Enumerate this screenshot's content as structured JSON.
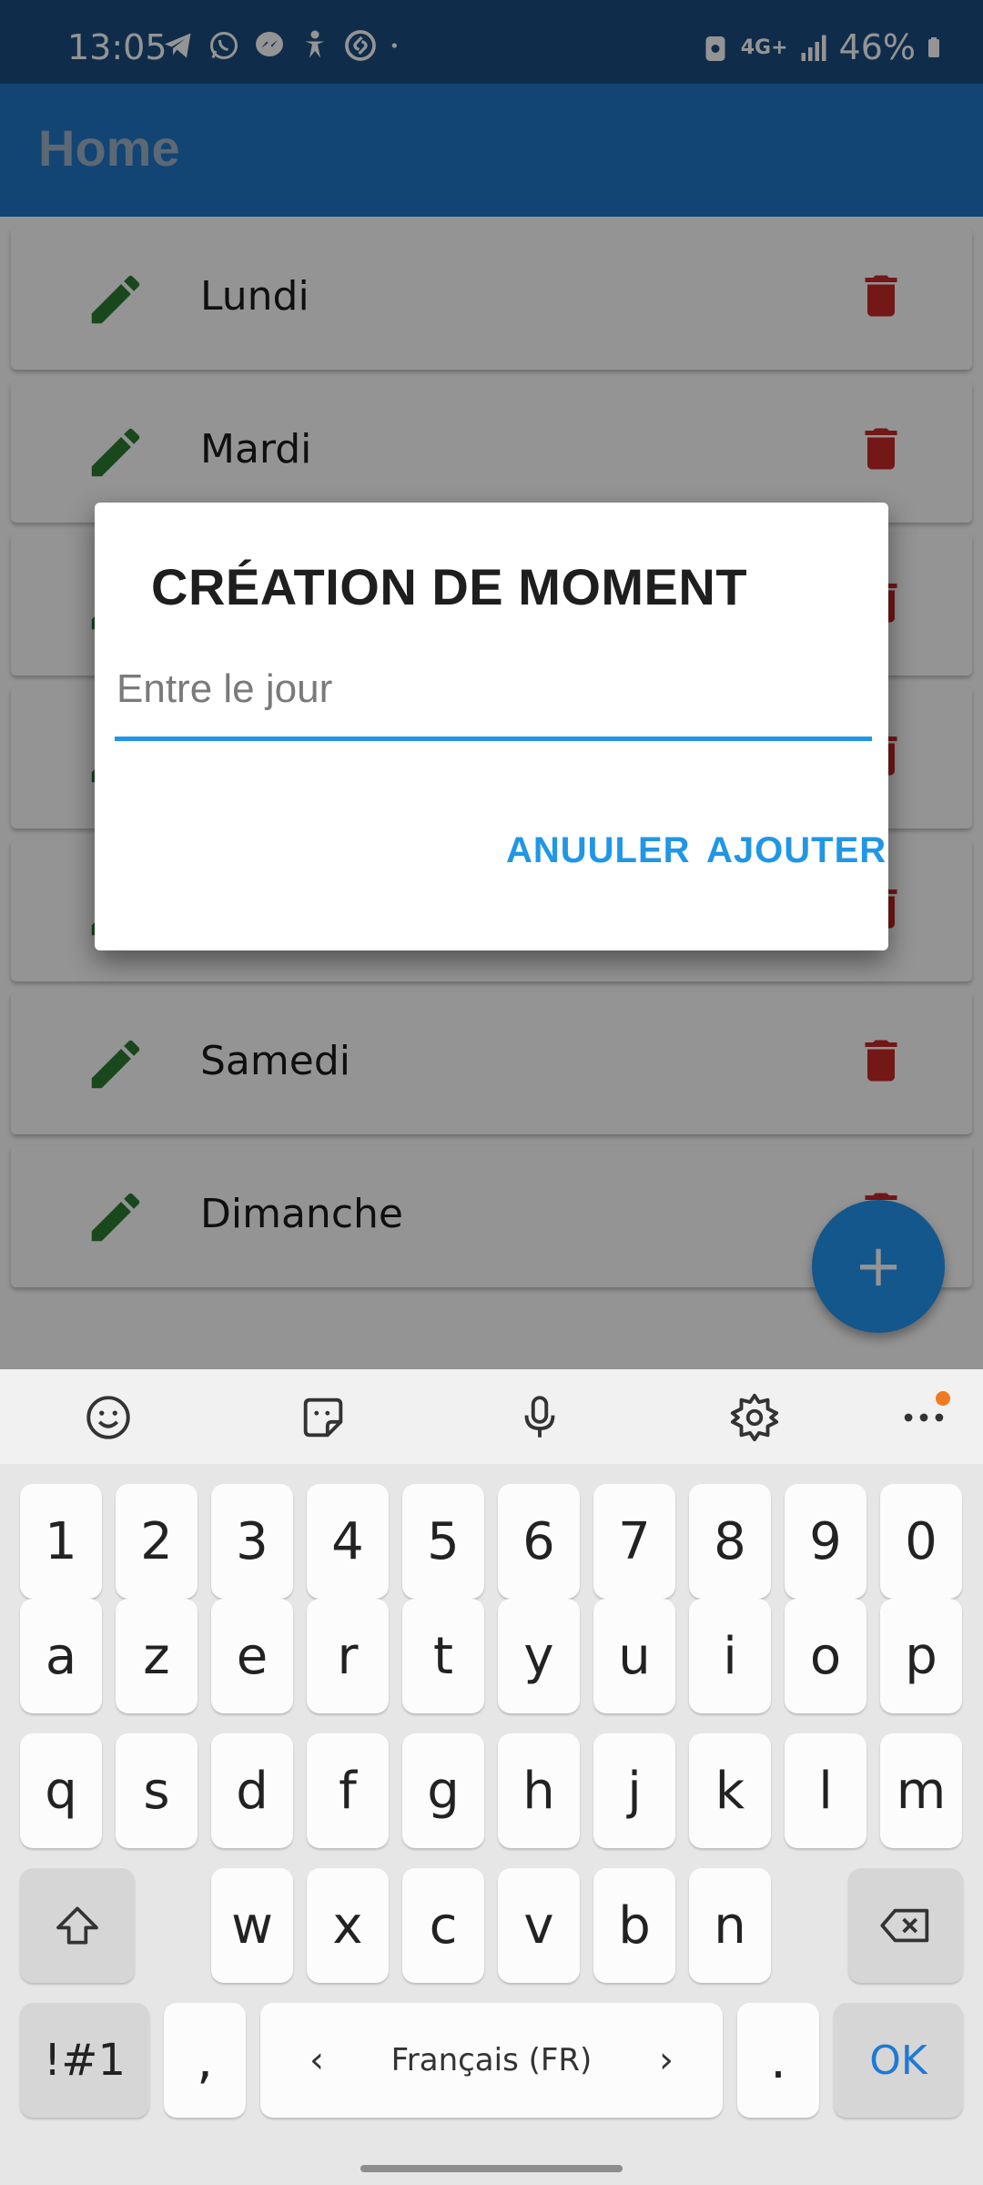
{
  "status_bar": {
    "time": "13:05",
    "battery": "46%",
    "network": "4G+",
    "notification_icons": [
      "telegram-icon",
      "whatsapp-icon",
      "messenger-icon",
      "accessibility-icon",
      "shazam-icon",
      "dot-icon"
    ]
  },
  "app_bar": {
    "title": "Home"
  },
  "list": {
    "items": [
      {
        "label": "Lundi"
      },
      {
        "label": "Mardi"
      },
      {
        "label": ""
      },
      {
        "label": ""
      },
      {
        "label": ""
      },
      {
        "label": "Samedi"
      },
      {
        "label": "Dimanche"
      }
    ]
  },
  "fab": {
    "label": "+"
  },
  "dialog": {
    "title": "CRÉATION DE MOMENT",
    "input_placeholder": "Entre le jour",
    "input_value": "",
    "cancel_label": "ANUULER",
    "add_label": "AJOUTER"
  },
  "keyboard": {
    "toolbar_icons": [
      "emoji-icon",
      "sticker-icon",
      "microphone-icon",
      "settings-icon",
      "more-icon"
    ],
    "row_numbers": [
      "1",
      "2",
      "3",
      "4",
      "5",
      "6",
      "7",
      "8",
      "9",
      "0"
    ],
    "row1": [
      "a",
      "z",
      "e",
      "r",
      "t",
      "y",
      "u",
      "i",
      "o",
      "p"
    ],
    "row2": [
      "q",
      "s",
      "d",
      "f",
      "g",
      "h",
      "j",
      "k",
      "l",
      "m"
    ],
    "row3": [
      "w",
      "x",
      "c",
      "v",
      "b",
      "n"
    ],
    "symbols_label": "!#1",
    "comma": ",",
    "space_label": "Français (FR)",
    "period": ".",
    "ok_label": "OK"
  },
  "colors": {
    "app_bar": "#1f78c8",
    "accent": "#2196e6",
    "edit_icon": "#2e7d32",
    "delete_icon": "#c62828"
  }
}
